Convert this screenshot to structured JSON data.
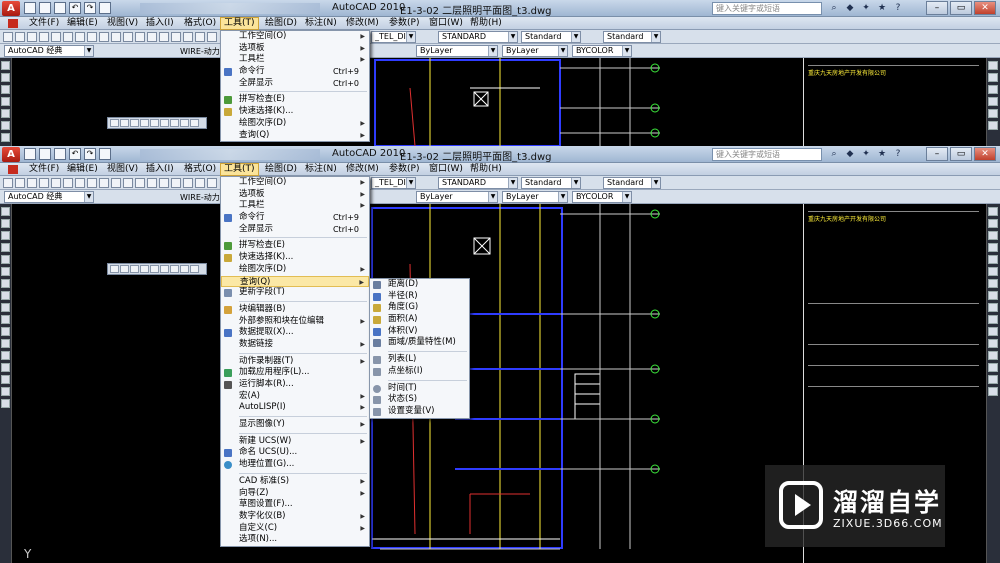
{
  "app": {
    "title": "AutoCAD 2010",
    "file": "E1-3-02 二层照明平面图_t3.dwg",
    "search_placeholder": "键入关键字或短语"
  },
  "menubar": [
    {
      "label": "文件(F)"
    },
    {
      "label": "编辑(E)"
    },
    {
      "label": "视图(V)"
    },
    {
      "label": "插入(I)"
    },
    {
      "label": "格式(O)"
    },
    {
      "label": "工具(T)"
    },
    {
      "label": "绘图(D)"
    },
    {
      "label": "标注(N)"
    },
    {
      "label": "修改(M)"
    },
    {
      "label": "参数(P)"
    },
    {
      "label": "窗口(W)"
    },
    {
      "label": "帮助(H)"
    }
  ],
  "toolbar": {
    "workspace": "AutoCAD 经典",
    "layer": "WIRE-动力",
    "dim_style": "_TEL_DIM",
    "text_style": "STANDARD",
    "table_style": "Standard",
    "mleader_style": "Standard",
    "linetype": "ByLayer",
    "lineweight": "ByLayer",
    "color": "BYCOLOR"
  },
  "tools_menu": {
    "items": [
      {
        "label": "工作空间(O)",
        "submenu": true
      },
      {
        "label": "选项板",
        "submenu": true
      },
      {
        "label": "工具栏",
        "submenu": true
      },
      {
        "label": "命令行",
        "shortcut": "Ctrl+9",
        "icon": "command-line-icon"
      },
      {
        "label": "全屏显示",
        "shortcut": "Ctrl+0"
      },
      {
        "label": "拼写检查(E)",
        "icon": "spell-check-icon"
      },
      {
        "label": "快速选择(K)...",
        "icon": "quick-select-icon"
      },
      {
        "label": "绘图次序(D)",
        "submenu": true
      },
      {
        "label": "查询(Q)",
        "submenu": true
      },
      {
        "label": "更新字段(T)",
        "icon": "update-field-icon"
      },
      {
        "label": "块编辑器(B)",
        "icon": "block-editor-icon"
      },
      {
        "label": "外部参照和块在位编辑",
        "submenu": true
      },
      {
        "label": "数据提取(X)...",
        "icon": "data-extract-icon"
      },
      {
        "label": "数据链接",
        "submenu": true
      },
      {
        "label": "动作录制器(T)",
        "submenu": true
      },
      {
        "label": "加载应用程序(L)...",
        "icon": "load-app-icon"
      },
      {
        "label": "运行脚本(R)...",
        "icon": "run-script-icon"
      },
      {
        "label": "宏(A)",
        "submenu": true
      },
      {
        "label": "AutoLISP(I)",
        "submenu": true
      },
      {
        "label": "显示图像(Y)",
        "submenu": true
      },
      {
        "label": "新建 UCS(W)",
        "submenu": true
      },
      {
        "label": "命名 UCS(U)...",
        "icon": "named-ucs-icon"
      },
      {
        "label": "地理位置(G)...",
        "icon": "geo-location-icon"
      },
      {
        "label": "CAD 标准(S)",
        "submenu": true
      },
      {
        "label": "向导(Z)",
        "submenu": true
      },
      {
        "label": "草图设置(F)..."
      },
      {
        "label": "数字化仪(B)",
        "submenu": true
      },
      {
        "label": "自定义(C)",
        "submenu": true
      },
      {
        "label": "选项(N)..."
      }
    ]
  },
  "inquiry_menu": {
    "items": [
      {
        "label": "距离(D)",
        "icon": "distance-icon"
      },
      {
        "label": "半径(R)",
        "icon": "radius-icon"
      },
      {
        "label": "角度(G)",
        "icon": "angle-icon"
      },
      {
        "label": "面积(A)",
        "icon": "area-icon"
      },
      {
        "label": "体积(V)",
        "icon": "volume-icon"
      },
      {
        "label": "面域/质量特性(M)",
        "icon": "mass-properties-icon"
      },
      {
        "label": "列表(L)",
        "icon": "list-icon"
      },
      {
        "label": "点坐标(I)",
        "icon": "point-coords-icon"
      },
      {
        "label": "时间(T)",
        "icon": "time-icon"
      },
      {
        "label": "状态(S)",
        "icon": "status-icon"
      },
      {
        "label": "设置变量(V)",
        "icon": "set-variable-icon"
      }
    ]
  },
  "title_block": {
    "company": "重庆九天房地产开发有限公司"
  },
  "drawing": {
    "ucs_axis": "Y"
  },
  "watermark": {
    "name": "溜溜自学",
    "url": "ZIXUE.3D66.COM"
  }
}
